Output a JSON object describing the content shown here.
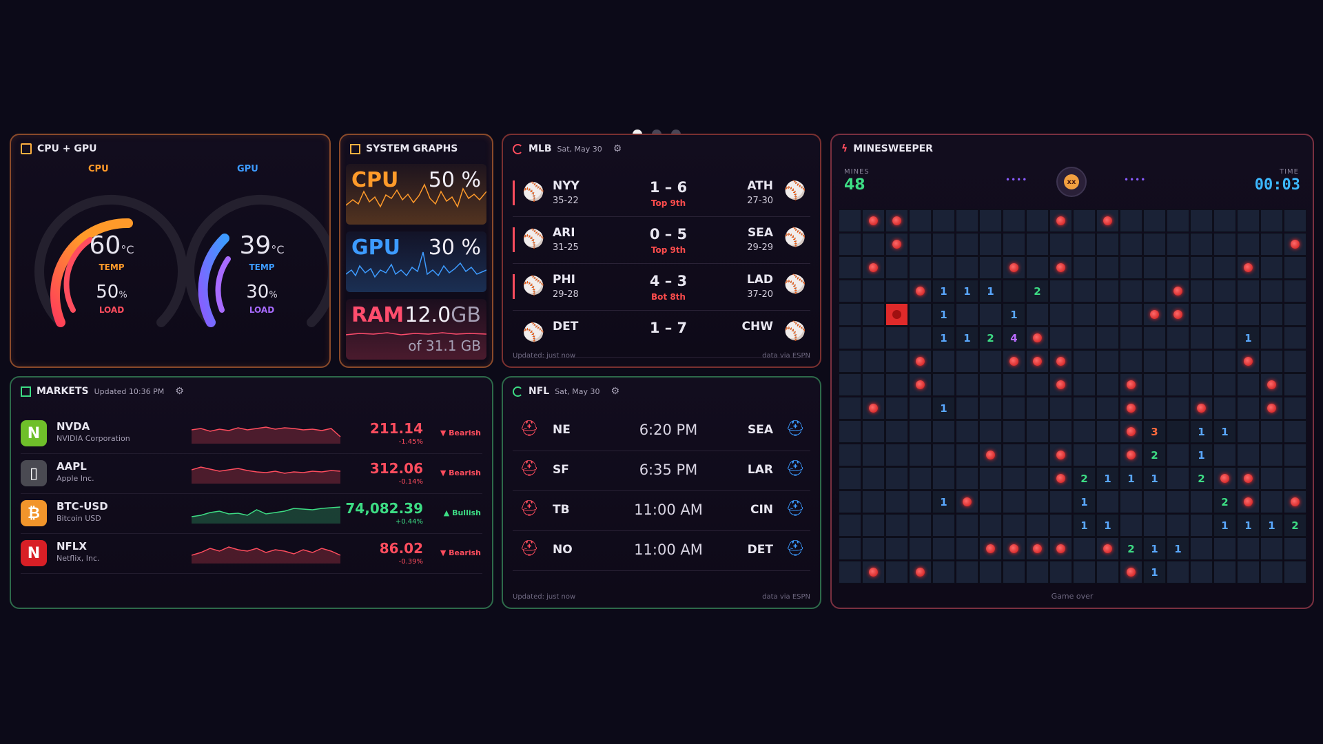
{
  "pager": {
    "active": 0,
    "count": 3
  },
  "cpu_gpu": {
    "title": "CPU + GPU",
    "cpu": {
      "label": "CPU",
      "temp": "60",
      "temp_unit": "°C",
      "temp_label": "TEMP",
      "load": "50",
      "load_unit": "%",
      "load_label": "LOAD",
      "temp_value": 60,
      "load_value": 50
    },
    "gpu": {
      "label": "GPU",
      "temp": "39",
      "temp_unit": "°C",
      "temp_label": "TEMP",
      "load": "30",
      "load_unit": "%",
      "load_label": "LOAD",
      "temp_value": 39,
      "load_value": 30
    }
  },
  "system_graphs": {
    "title": "SYSTEM GRAPHS",
    "cpu": {
      "label": "CPU",
      "value": "50 %"
    },
    "gpu": {
      "label": "GPU",
      "value": "30 %"
    },
    "ram": {
      "label": "RAM",
      "value": "12.0",
      "unit": "GB",
      "total": "of 31.1 GB"
    }
  },
  "mlb": {
    "title": "MLB",
    "date": "Sat, May 30",
    "games": [
      {
        "away": "NYY",
        "away_rec": "35-22",
        "score": "1 – 6",
        "status": "Top 9th",
        "home": "ATH",
        "home_rec": "27-30"
      },
      {
        "away": "ARI",
        "away_rec": "31-25",
        "score": "0 – 5",
        "status": "Top 9th",
        "home": "SEA",
        "home_rec": "29-29"
      },
      {
        "away": "PHI",
        "away_rec": "29-28",
        "score": "4 – 3",
        "status": "Bot 8th",
        "home": "LAD",
        "home_rec": "37-20"
      },
      {
        "away": "DET",
        "away_rec": "",
        "score": "1 – 7",
        "status": "",
        "home": "CHW",
        "home_rec": ""
      }
    ],
    "updated": "Updated: just now",
    "source": "data via ESPN"
  },
  "nfl": {
    "title": "NFL",
    "date": "Sat, May 30",
    "games": [
      {
        "away": "NE",
        "time": "6:20 PM",
        "home": "SEA"
      },
      {
        "away": "SF",
        "time": "6:35 PM",
        "home": "LAR"
      },
      {
        "away": "TB",
        "time": "11:00 AM",
        "home": "CIN"
      },
      {
        "away": "NO",
        "time": "11:00 AM",
        "home": "DET"
      }
    ],
    "updated": "Updated: just now",
    "source": "data via ESPN"
  },
  "markets": {
    "title": "MARKETS",
    "updated": "Updated 10:36 PM",
    "items": [
      {
        "logo": "N",
        "symbol": "NVDA",
        "name": "NVIDIA Corporation",
        "price": "211.14",
        "change": "-1.45%",
        "sentiment": "▼ Bearish",
        "color": "#ff4d5e",
        "logo_bg": "#6fbf2a"
      },
      {
        "logo": "▯",
        "symbol": "AAPL",
        "name": "Apple Inc.",
        "price": "312.06",
        "change": "-0.14%",
        "sentiment": "▼ Bearish",
        "color": "#ff4d5e",
        "logo_bg": "#4a4a52"
      },
      {
        "logo": "₿",
        "symbol": "BTC-USD",
        "name": "Bitcoin USD",
        "price": "74,082.39",
        "change": "+0.44%",
        "sentiment": "▲ Bullish",
        "color": "#3ddc84",
        "logo_bg": "#f2952b"
      },
      {
        "logo": "N",
        "symbol": "NFLX",
        "name": "Netflix, Inc.",
        "price": "86.02",
        "change": "-0.39%",
        "sentiment": "▼ Bearish",
        "color": "#ff4d5e",
        "logo_bg": "#d81f26"
      }
    ]
  },
  "minesweeper": {
    "title": "MINESWEEPER",
    "mines_label": "MINES",
    "mines": "48",
    "time_label": "TIME",
    "time": "00:03",
    "status": "Game over",
    "grid": [
      ".MM......M.M........",
      "..M................M",
      ".M.....M.M.......M..",
      "...M111 2.....M.....",
      "..X.1..1.....MM.....",
      "....1124M........1..",
      "...M...MMM.......M..",
      "...M.....M..M.....M.",
      ".M..1.......M..M..M.",
      "............M3 11...",
      "......M..M..M2.1....",
      ".........M2111.2MM..",
      "....1M....1.....2M.M",
      "..........11....1112M",
      "......MMMM.M211......11",
      ".M.M........M1......."
    ]
  },
  "colors": {
    "cpu": "#ff9a2a",
    "gpu": "#3d9bff",
    "ram": "#ff4d6d",
    "accent_green": "#3ddc84",
    "accent_red": "#ff4d5e"
  }
}
